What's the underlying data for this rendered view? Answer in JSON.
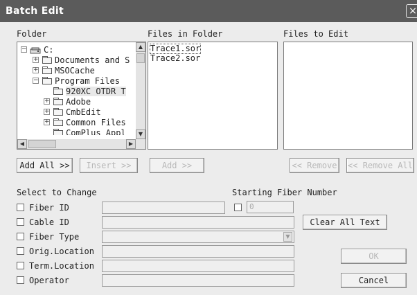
{
  "window": {
    "title": "Batch Edit",
    "close_label": "×"
  },
  "sections": {
    "folder_label": "Folder",
    "files_in_folder_label": "Files in Folder",
    "files_to_edit_label": "Files to Edit"
  },
  "tree": {
    "root": "C:",
    "items": [
      "Documents and S",
      "MSOCache",
      "Program Files",
      "920XC OTDR T",
      "Adobe",
      "CmbEdit",
      "Common Files",
      "ComPlus Appl"
    ]
  },
  "files_in_folder": [
    "Trace1.sor",
    "Trace2.sor"
  ],
  "files_to_edit": [],
  "buttons": {
    "add_all": "Add All >>",
    "insert": "Insert >>",
    "add": "Add >>",
    "remove": "<< Remove",
    "remove_all": "<< Remove All",
    "clear_all_text": "Clear All Text",
    "ok": "OK",
    "cancel": "Cancel"
  },
  "select_to_change": {
    "label": "Select to Change",
    "fields": {
      "fiber_id": "Fiber ID",
      "cable_id": "Cable ID",
      "fiber_type": "Fiber Type",
      "orig_location": "Orig.Location",
      "term_location": "Term.Location",
      "operator": "Operator"
    }
  },
  "starting_fiber": {
    "label": "Starting Fiber Number",
    "value": "0"
  },
  "icons": {
    "drive": "drive-icon",
    "folder": "folder-icon",
    "expand": "plus-expander-icon",
    "collapse": "minus-expander-icon"
  }
}
